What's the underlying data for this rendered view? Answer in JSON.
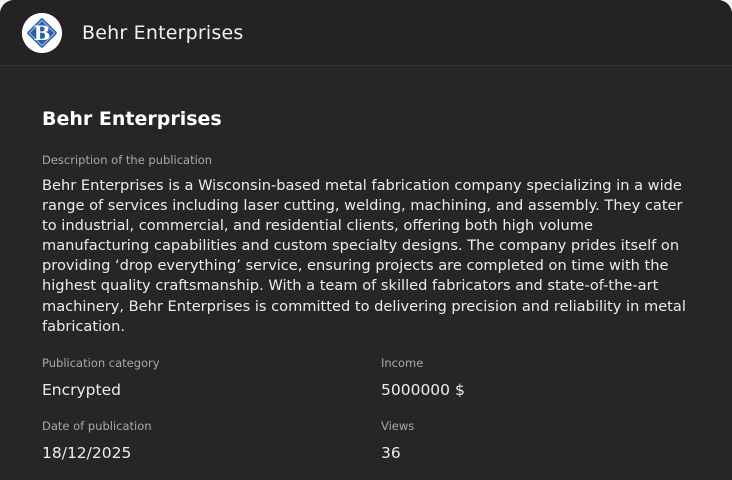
{
  "header": {
    "title": "Behr Enterprises",
    "logo_letter": "B"
  },
  "publication": {
    "title": "Behr Enterprises",
    "description_label": "Description of the publication",
    "description": "Behr Enterprises is a Wisconsin-based metal fabrication company specializing in a wide range of services including laser cutting, welding, machining, and assembly. They cater to industrial, commercial, and residential clients, offering both high volume manufacturing capabilities and custom specialty designs. The company prides itself on providing ‘drop everything’ service, ensuring projects are completed on time with the highest quality craftsmanship. With a team of skilled fabricators and state-of-the-art machinery, Behr Enterprises is committed to delivering precision and reliability in metal fabrication.",
    "category_label": "Publication category",
    "category": "Encrypted",
    "income_label": "Income",
    "income": "5000000 $",
    "date_label": "Date of publication",
    "date": "18/12/2025",
    "views_label": "Views",
    "views": "36"
  },
  "colors": {
    "background": "#262626",
    "header": "#232323",
    "logo_blue": "#2f5fa8",
    "text": "#ececec",
    "muted": "#a9a9a9"
  }
}
